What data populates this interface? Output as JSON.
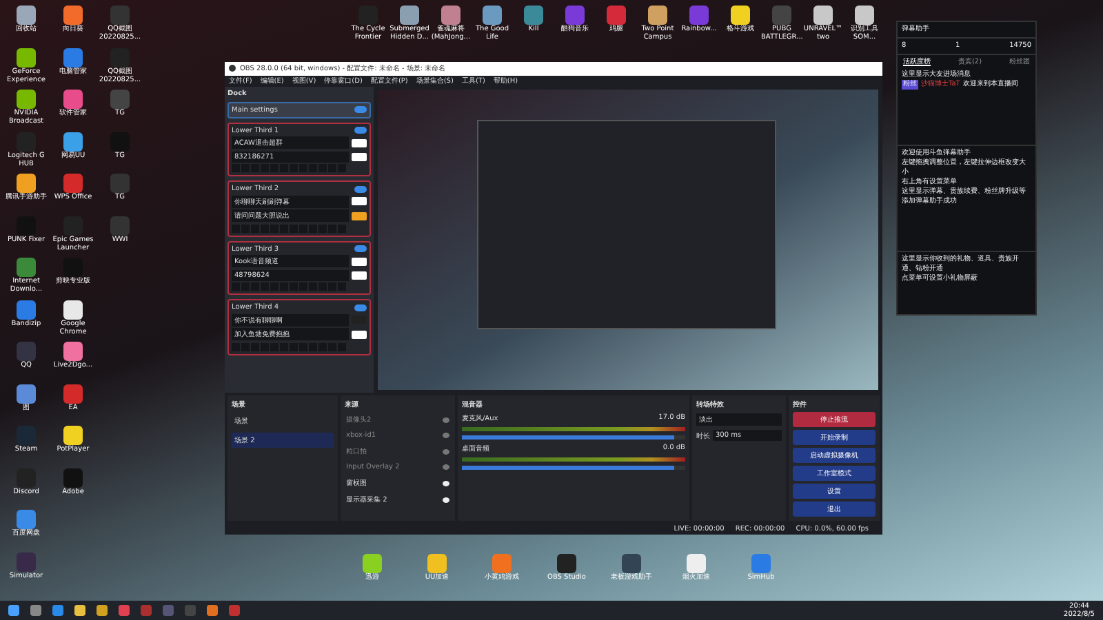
{
  "desktop_left_icons": [
    {
      "label": "回收站",
      "color": "#9aa7b8"
    },
    {
      "label": "向日葵",
      "color": "#f26b2a"
    },
    {
      "label": "QQ截图20220825...",
      "color": "#333333"
    },
    {
      "label": "GeForce Experience",
      "color": "#76b900"
    },
    {
      "label": "电脑管家",
      "color": "#2a7be4"
    },
    {
      "label": "QQ截图20220825...",
      "color": "#222222"
    },
    {
      "label": "NVIDIA Broadcast",
      "color": "#76b900"
    },
    {
      "label": "软件管家",
      "color": "#e84c8a"
    },
    {
      "label": "TG",
      "color": "#444444"
    },
    {
      "label": "Logitech G HUB",
      "color": "#222222"
    },
    {
      "label": "网易UU",
      "color": "#3aa0e8"
    },
    {
      "label": "TG",
      "color": "#111111"
    },
    {
      "label": "腾讯手游助手",
      "color": "#f0a020"
    },
    {
      "label": "WPS Office",
      "color": "#d42a2a"
    },
    {
      "label": "TG",
      "color": "#333333"
    },
    {
      "label": "PUNK Fixer",
      "color": "#111111"
    },
    {
      "label": "Epic Games Launcher",
      "color": "#222222"
    },
    {
      "label": "WWI",
      "color": "#333333"
    },
    {
      "label": "Internet Downlo...",
      "color": "#3a8a3a"
    },
    {
      "label": "剪映专业版",
      "color": "#111111"
    },
    {
      "label": "Bandizip",
      "color": "#2a7be4"
    },
    {
      "label": "Google Chrome",
      "color": "#e8e8e8"
    },
    {
      "label": "QQ",
      "color": "#333344"
    },
    {
      "label": "Live2Dgo...",
      "color": "#f070a0"
    },
    {
      "label": "图",
      "color": "#5a8ad8"
    },
    {
      "label": "EA",
      "color": "#d42a2a"
    },
    {
      "label": "Steam",
      "color": "#1b2838"
    },
    {
      "label": "PotPlayer",
      "color": "#f0d020"
    },
    {
      "label": "Discord",
      "color": "#222222"
    },
    {
      "label": "Adobe",
      "color": "#111111"
    },
    {
      "label": "百度网盘",
      "color": "#3a8ae8"
    },
    {
      "label": "Simulator",
      "color": "#3a2a4a"
    }
  ],
  "desktop_top_icons": [
    {
      "label": "The Cycle Frontier",
      "color": "#222222"
    },
    {
      "label": "Submerged Hidden D...",
      "color": "#8aa0b0"
    },
    {
      "label": "雀魂麻将 (MahJong...",
      "color": "#c08090"
    },
    {
      "label": "The Good Life",
      "color": "#6a9ac0"
    },
    {
      "label": "Kill",
      "color": "#3a8a9a"
    },
    {
      "label": "酷狗音乐",
      "color": "#7a3ad8"
    },
    {
      "label": "鸡腿",
      "color": "#d42a3a"
    },
    {
      "label": "Two Point Campus",
      "color": "#d0a060"
    },
    {
      "label": "Rainbow...",
      "color": "#7a3ad8"
    },
    {
      "label": "格斗游戏",
      "color": "#f0d020"
    },
    {
      "label": "PUBG BATTLEGR...",
      "color": "#444444"
    },
    {
      "label": "UNRAVEL™ two",
      "color": "#c8c8c8"
    },
    {
      "label": "识别工具 SOM...",
      "color": "#c8c8c8"
    }
  ],
  "desktop_bottom_icons": [
    {
      "label": "迅游",
      "color": "#8ad020"
    },
    {
      "label": "UU加速",
      "color": "#f0c020"
    },
    {
      "label": "小黄鸡游戏",
      "color": "#f07020"
    },
    {
      "label": "OBS Studio",
      "color": "#222222"
    },
    {
      "label": "老板游戏助手",
      "color": "#334455"
    },
    {
      "label": "烟火加速",
      "color": "#eeeeee"
    },
    {
      "label": "SimHub",
      "color": "#2a7be4"
    }
  ],
  "obs": {
    "title": "OBS 28.0.0 (64 bit, windows) - 配置文件: 未命名 - 场景: 未命名",
    "menu": [
      "文件(F)",
      "编辑(E)",
      "视图(V)",
      "停靠窗口(D)",
      "配置文件(P)",
      "场景集合(S)",
      "工具(T)",
      "帮助(H)"
    ],
    "dock": {
      "title": "Dock",
      "main_settings": {
        "label": "Main settings",
        "on": true
      },
      "lower_thirds": [
        {
          "label": "Lower Third 1",
          "on": true,
          "lines": [
            {
              "text": "ACAW退击超群",
              "color": "#ffffff"
            },
            {
              "text": "832186271",
              "color": "#ffffff"
            }
          ]
        },
        {
          "label": "Lower Third 2",
          "on": true,
          "lines": [
            {
              "text": "你聊聊天刷刷弹幕",
              "color": "#ffffff"
            },
            {
              "text": "请问问题大胆说出",
              "color": "#f0a020"
            }
          ]
        },
        {
          "label": "Lower Third 3",
          "on": true,
          "lines": [
            {
              "text": "Kook语音频道",
              "color": "#ffffff"
            },
            {
              "text": "48798624",
              "color": "#ffffff"
            }
          ]
        },
        {
          "label": "Lower Third 4",
          "on": true,
          "lines": [
            {
              "text": "你不说有聊聊啊",
              "color": "#222222"
            },
            {
              "text": "加入鱼塘免费抱抱",
              "color": "#ffffff"
            }
          ]
        }
      ]
    },
    "scenes": {
      "title": "场景",
      "items": [
        {
          "label": "场景",
          "selected": false
        },
        {
          "label": "场景 2",
          "selected": true
        }
      ]
    },
    "sources": {
      "title": "来源",
      "items": [
        {
          "label": "摄像头2",
          "visible": false
        },
        {
          "label": "xbox-id1",
          "visible": false
        },
        {
          "label": "粒口拍",
          "visible": false
        },
        {
          "label": "Input Overlay 2",
          "visible": false
        },
        {
          "label": "窗棂图",
          "visible": true
        },
        {
          "label": "显示器采集 2",
          "visible": true
        }
      ]
    },
    "mixer": {
      "title": "混音器",
      "channels": [
        {
          "name": "麦克风/Aux",
          "reading": "17.0 dB",
          "level": 0.95
        },
        {
          "name": "桌面音频",
          "reading": "0.0 dB",
          "level": 0.95
        }
      ]
    },
    "transitions": {
      "title": "转场特效",
      "type": "淡出",
      "duration_label": "时长",
      "duration": "300 ms"
    },
    "controls": {
      "title": "控件",
      "buttons": [
        {
          "label": "停止推流",
          "kind": "active"
        },
        {
          "label": "开始录制",
          "kind": "normal"
        },
        {
          "label": "启动虚拟摄像机",
          "kind": "normal"
        },
        {
          "label": "工作室模式",
          "kind": "normal"
        },
        {
          "label": "设置",
          "kind": "normal"
        },
        {
          "label": "退出",
          "kind": "normal"
        }
      ]
    },
    "status": {
      "live": "LIVE: 00:00:00",
      "rec": "REC: 00:00:00",
      "cpu": "CPU: 0.0%, 60.00 fps"
    }
  },
  "chat": {
    "title": "弹幕助手",
    "stats": [
      "8",
      "1",
      "14750"
    ],
    "tabs": [
      {
        "label": "活跃度榜",
        "selected": true
      },
      {
        "label": "贵宾(2)",
        "selected": false
      },
      {
        "label": "粉丝团",
        "selected": false
      }
    ],
    "notice": "这里显示大友进场消息",
    "badge": "粉丝",
    "user": "沙猫博士TaT",
    "welcome": "欢迎来到本直播间",
    "help": [
      "欢迎使用斗鱼弹幕助手",
      "左键拖拽调整位置，左键拉伸边框改变大小",
      "右上角有设置菜单",
      "这里显示弹幕、贵族续费、粉丝牌升级等",
      "添加弹幕助手成功"
    ],
    "gifts": [
      "这里显示你收到的礼物、道具、贵族开通、钻粉开通",
      "点菜单可设置小礼物屏蔽"
    ]
  },
  "taskbar": {
    "time": "20:44",
    "date": "2022/8/5"
  }
}
